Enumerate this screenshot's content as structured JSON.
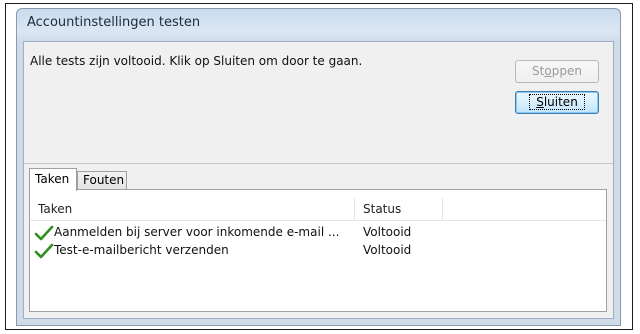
{
  "window": {
    "title": "Accountinstellingen testen"
  },
  "message": "Alle tests zijn voltooid. Klik op Sluiten om door te gaan.",
  "buttons": {
    "stop": {
      "label_pre": "St",
      "label_u": "o",
      "label_post": "ppen",
      "enabled": false
    },
    "close": {
      "label_pre": "",
      "label_u": "S",
      "label_post": "luiten",
      "enabled": true
    }
  },
  "tabs": [
    {
      "label": "Taken",
      "active": true
    },
    {
      "label": "Fouten",
      "active": false
    }
  ],
  "table": {
    "headers": {
      "task": "Taken",
      "status": "Status"
    },
    "rows": [
      {
        "icon": "checkmark-icon",
        "task": "Aanmelden bij server voor inkomende e-mail ...",
        "status": "Voltooid"
      },
      {
        "icon": "checkmark-icon",
        "task": "Test-e-mailbericht verzenden",
        "status": "Voltooid"
      }
    ]
  },
  "colors": {
    "check": "#2f8f1f",
    "default_button_border": "#3c7fb1"
  }
}
